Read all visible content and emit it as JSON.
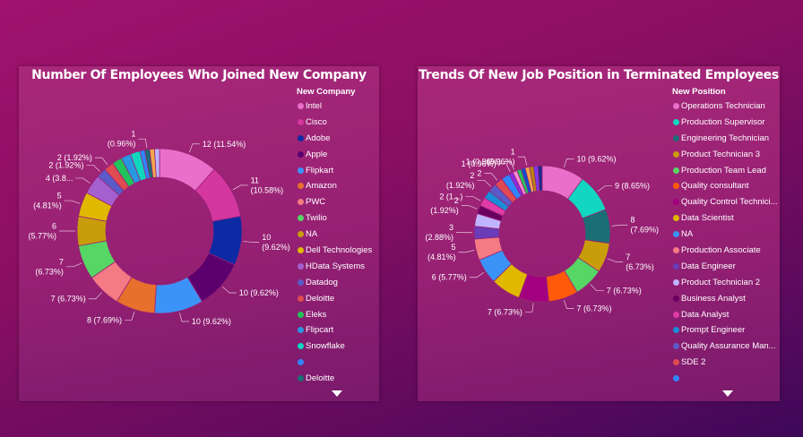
{
  "chart_data": [
    {
      "type": "pie",
      "title": "Number Of Employees Who Joined New Company",
      "legend_title": "New Company",
      "donut": true,
      "legend_position": "right",
      "slices": [
        {
          "label": "Intel",
          "value": 12,
          "data_label": "12 (11.54%)",
          "color": "#e96fcb"
        },
        {
          "label": "Cisco",
          "value": 11,
          "data_label": "11\n(10.58%)",
          "color": "#d4379f"
        },
        {
          "label": "Adobe",
          "value": 10,
          "data_label": "10\n(9.62%)",
          "color": "#0b2aa3"
        },
        {
          "label": "Apple",
          "value": 10,
          "data_label": "10 (9.62%)",
          "color": "#5c006e"
        },
        {
          "label": "Flipkart",
          "value": 10,
          "data_label": "10 (9.62%)",
          "color": "#3b93f7"
        },
        {
          "label": "Amazon",
          "value": 8,
          "data_label": "8 (7.69%)",
          "color": "#e8702d"
        },
        {
          "label": "PWC",
          "value": 7,
          "data_label": "7 (6.73%)",
          "color": "#f47a84"
        },
        {
          "label": "Twilio",
          "value": 7,
          "data_label": "7\n(6.73%)",
          "color": "#56d664"
        },
        {
          "label": "NA",
          "value": 6,
          "data_label": "6\n(5.77%)",
          "color": "#c99d0a"
        },
        {
          "label": "Dell Technologies",
          "value": 5,
          "data_label": "5\n(4.81%)",
          "color": "#e1b800"
        },
        {
          "label": "HData Systems",
          "value": 4,
          "data_label": "4 (3.8...",
          "color": "#a560cf"
        },
        {
          "label": "Datadog",
          "value": 2,
          "data_label": "2 (1.92%)",
          "color": "#5a5bc8"
        },
        {
          "label": "Deloitte",
          "value": 2,
          "data_label": "2 (1.92%)",
          "color": "#e04a52"
        },
        {
          "label": "Eleks",
          "value": 2,
          "data_label": "",
          "color": "#21c45a"
        },
        {
          "label": "Flipcart",
          "value": 2,
          "data_label": "",
          "color": "#2896e0"
        },
        {
          "label": "Snowflake",
          "value": 2,
          "data_label": "",
          "color": "#12d6c0"
        },
        {
          "label": "",
          "value": 1,
          "data_label": "",
          "color": "#2f86ff"
        },
        {
          "label": "Deloitte",
          "value": 1,
          "data_label": "1\n(0.96%)",
          "color": "#1a6e74"
        },
        {
          "label": "",
          "value": 1,
          "data_label": "",
          "color": "#f2a74b"
        },
        {
          "label": "",
          "value": 1,
          "data_label": "",
          "color": "#c0b3ff"
        }
      ]
    },
    {
      "type": "pie",
      "title": "Trends Of New Job Position in Terminated Employees",
      "legend_title": "New Position",
      "donut": true,
      "legend_position": "right",
      "slices": [
        {
          "label": "Operations Technician",
          "value": 10,
          "data_label": "10 (9.62%)",
          "color": "#e96fcb"
        },
        {
          "label": "Production Supervisor",
          "value": 9,
          "data_label": "9 (8.65%)",
          "color": "#12d6c0"
        },
        {
          "label": "Engineering Technician",
          "value": 8,
          "data_label": "8\n(7.69%)",
          "color": "#1a6e74"
        },
        {
          "label": "Product Technician 3",
          "value": 7,
          "data_label": "7\n(6.73%)",
          "color": "#c99d0a"
        },
        {
          "label": "Production Team Lead",
          "value": 7,
          "data_label": "7 (6.73%)",
          "color": "#56d664"
        },
        {
          "label": "Quality consultant",
          "value": 7,
          "data_label": "7 (6.73%)",
          "color": "#ff5a0a"
        },
        {
          "label": "Quality Control Technici...",
          "value": 7,
          "data_label": "7 (6.73%)",
          "color": "#a3007f"
        },
        {
          "label": "Data Scientist",
          "value": 7,
          "data_label": "",
          "color": "#e1b800"
        },
        {
          "label": "NA",
          "value": 6,
          "data_label": "6 (5.77%)",
          "color": "#3b93f7"
        },
        {
          "label": "Production Associate",
          "value": 5,
          "data_label": "5\n(4.81%)",
          "color": "#f47a84"
        },
        {
          "label": "Data Engineer",
          "value": 3,
          "data_label": "3\n(2.88%)",
          "color": "#6a3cb8"
        },
        {
          "label": "Product Technician 2",
          "value": 3,
          "data_label": "",
          "color": "#c0b3ff"
        },
        {
          "label": "Business Analyst",
          "value": 2,
          "data_label": "2\n(1.92%)",
          "color": "#6b0060"
        },
        {
          "label": "Data Analyst",
          "value": 2,
          "data_label": "2 (1...)",
          "color": "#e03ca8"
        },
        {
          "label": "Prompt Engineer",
          "value": 2,
          "data_label": "",
          "color": "#1a8cd8"
        },
        {
          "label": "Quality Assurance Man...",
          "value": 2,
          "data_label": "2\n(1.92%)",
          "color": "#5a5bc8"
        },
        {
          "label": "SDE 2",
          "value": 2,
          "data_label": "2",
          "color": "#e04a52"
        },
        {
          "label": "",
          "value": 2,
          "data_label": "",
          "color": "#2f86ff"
        },
        {
          "label": "",
          "value": 1,
          "data_label": "1 (0.96%)",
          "color": "#8a2be2"
        },
        {
          "label": "",
          "value": 1,
          "data_label": "1 (0.96%)",
          "color": "#ff8ad1"
        },
        {
          "label": "",
          "value": 1,
          "data_label": "",
          "color": "#21c45a"
        },
        {
          "label": "",
          "value": 1,
          "data_label": "",
          "color": "#0e4fd1"
        },
        {
          "label": "",
          "value": 1,
          "data_label": "1\n(0.96%)",
          "color": "#f2a74b"
        },
        {
          "label": "",
          "value": 1,
          "data_label": "",
          "color": "#b8860b"
        },
        {
          "label": "",
          "value": 1,
          "data_label": "",
          "color": "#7c3aed"
        },
        {
          "label": "",
          "value": 1,
          "data_label": "",
          "color": "#1f2b8a"
        }
      ]
    }
  ],
  "ui": {
    "left_legend_items_visible": 18,
    "right_legend_items_visible": 18
  }
}
